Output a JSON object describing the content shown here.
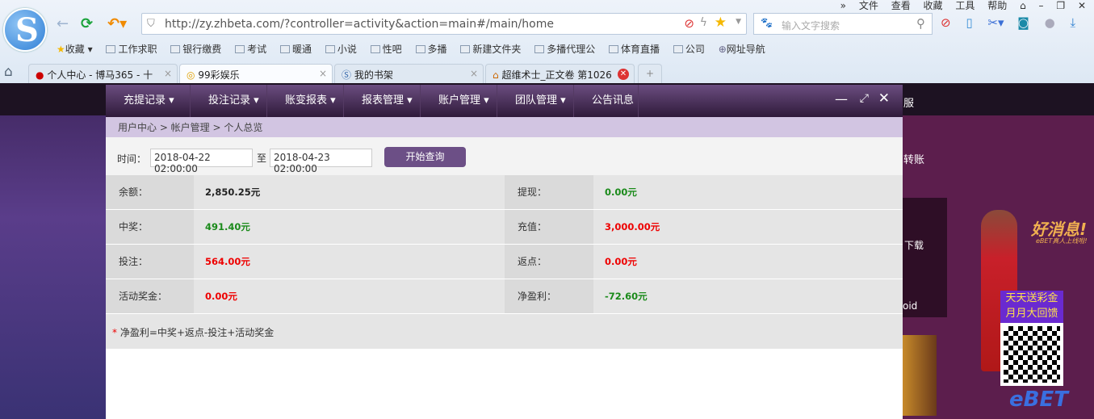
{
  "browser": {
    "menu": [
      "»",
      "文件",
      "查看",
      "收藏",
      "工具",
      "帮助"
    ],
    "url": "http://zy.zhbeta.com/?controller=activity&action=main#/main/home",
    "search_placeholder": "输入文字搜索",
    "bookmarks": [
      "收藏",
      "工作求职",
      "银行缴费",
      "考试",
      "暖通",
      "小说",
      "性吧",
      "多播",
      "新建文件夹",
      "多播代理公",
      "体育直播",
      "公司",
      "网址导航"
    ],
    "tabs": [
      {
        "label": "个人中心 - 博马365 - 十"
      },
      {
        "label": "99彩娱乐"
      },
      {
        "label": "我的书架"
      },
      {
        "label": "超维术士_正文卷 第1026"
      }
    ]
  },
  "site": {
    "right_fragments": [
      "服",
      "转账",
      "下载",
      "oid"
    ],
    "ad": {
      "headline": "好消息!",
      "sub": "eBET真人上线啦!",
      "promo1": "天天送彩金",
      "promo2": "月月大回馈",
      "brand": "eBET"
    }
  },
  "modal": {
    "nav": [
      "充提记录 ▾",
      "投注记录 ▾",
      "账变报表 ▾",
      "报表管理 ▾",
      "账户管理 ▾",
      "团队管理 ▾",
      "公告讯息"
    ],
    "breadcrumb": "用户中心 > 帐户管理 > 个人总览",
    "filter": {
      "label": "时间：",
      "start": "2018-04-22 02:00:00",
      "sep": "至",
      "end": "2018-04-23 02:00:00",
      "button": "开始查询"
    },
    "rows": [
      {
        "l1": "余额：",
        "v1": "2,850.25元",
        "l2": "提现：",
        "v2": "0.00元"
      },
      {
        "l1": "中奖：",
        "v1": "491.40元",
        "l2": "充值：",
        "v2": "3,000.00元"
      },
      {
        "l1": "投注：",
        "v1": "564.00元",
        "l2": "返点：",
        "v2": "0.00元"
      },
      {
        "l1": "活动奖金：",
        "v1": "0.00元",
        "l2": "净盈利：",
        "v2": "-72.60元"
      }
    ],
    "note_star": "*",
    "note": " 净盈利=中奖+返点-投注+活动奖金"
  }
}
